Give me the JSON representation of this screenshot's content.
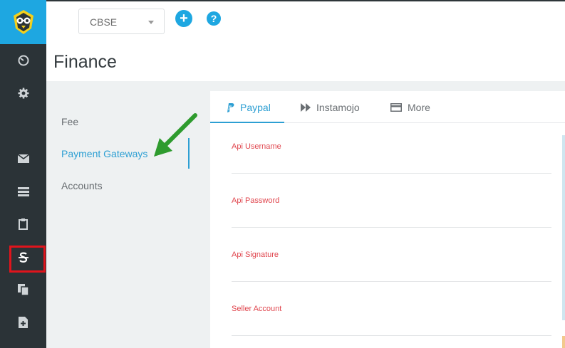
{
  "header": {
    "org_select_value": "CBSE",
    "add_label": "+",
    "help_label": "?"
  },
  "page": {
    "title": "Finance"
  },
  "nav": {
    "items": [
      {
        "label": "Fee"
      },
      {
        "label": "Payment Gateways"
      },
      {
        "label": "Accounts"
      }
    ]
  },
  "tabs": [
    {
      "label": "Paypal",
      "icon": "paypal-icon"
    },
    {
      "label": "Instamojo",
      "icon": "fast-forward-icon"
    },
    {
      "label": "More",
      "icon": "credit-card-icon"
    }
  ],
  "form": {
    "fields": [
      {
        "label": "Api Username",
        "value": ""
      },
      {
        "label": "Api Password",
        "value": ""
      },
      {
        "label": "Api Signature",
        "value": ""
      },
      {
        "label": "Seller Account",
        "value": ""
      }
    ]
  },
  "sidebar": {
    "icons": [
      "dashboard-icon",
      "settings-icon",
      "mail-icon",
      "list-icon",
      "clipboard-icon",
      "finance-icon",
      "copy-icon",
      "file-add-icon"
    ]
  },
  "colors": {
    "accent": "#1ea7e1",
    "sidebar": "#2b3337",
    "label_red": "#e0464e",
    "highlight_red": "#e0141c",
    "arrow_green": "#2e9b2e"
  }
}
